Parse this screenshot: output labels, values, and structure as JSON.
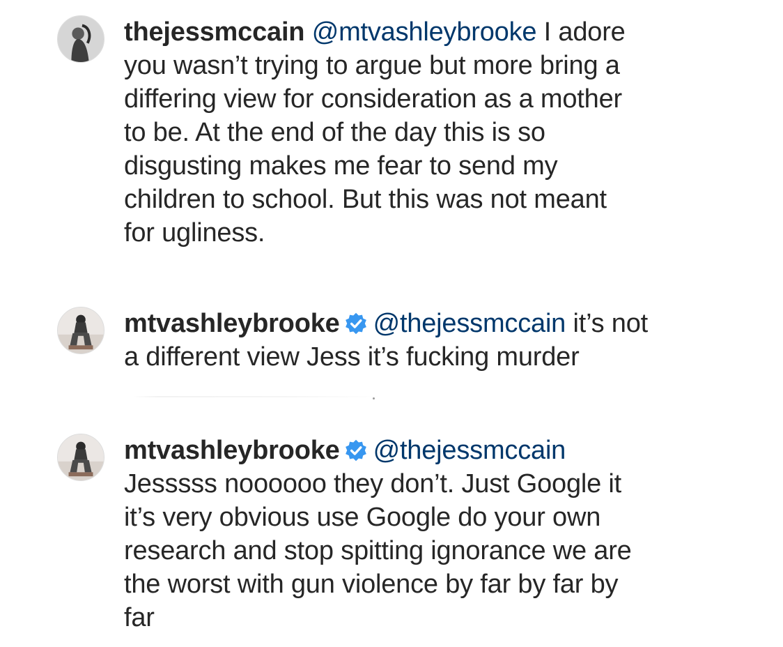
{
  "comments": [
    {
      "username": "thejessmccain",
      "verified": false,
      "mention": "@mtvashleybrooke",
      "lines": [
        "I adore",
        "you wasn’t trying to argue but more bring a",
        "differing view for consideration as a mother",
        "to be. At the end of the day this is so",
        "disgusting makes me fear to send my",
        "children to school. But this was not meant",
        "for ugliness."
      ]
    },
    {
      "username": "mtvashleybrooke",
      "verified": true,
      "mention": "@thejessmccain",
      "lines": [
        "it’s not",
        "a different view Jess it’s fucking murder"
      ]
    },
    {
      "username": "mtvashleybrooke",
      "verified": true,
      "mention": "@thejessmccain",
      "lines": [
        "",
        "Jesssss noooooo they don’t. Just Google it",
        "it’s very obvious use Google do your own",
        "research and stop spitting ignorance we are",
        "the worst with gun violence by far by far by",
        "far"
      ]
    }
  ],
  "colors": {
    "text": "#262626",
    "mention": "#00376b",
    "verified_badge": "#3897f0"
  },
  "icons": {
    "avatar": "profile-photo",
    "verified": "verified-badge-icon"
  }
}
